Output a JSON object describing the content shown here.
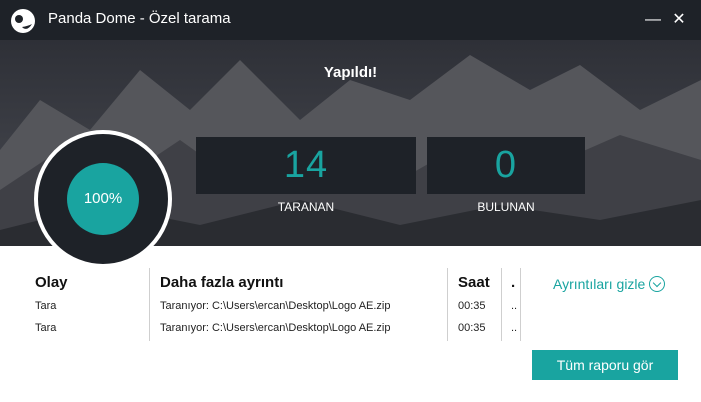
{
  "window": {
    "title": "Panda Dome - Özel tarama",
    "minimize_label": "—",
    "close_label": "✕"
  },
  "hero": {
    "status_text": "Yapıldı!",
    "scanned_count": "14",
    "scanned_label": "TARANAN",
    "found_count": "0",
    "found_label": "BULUNAN",
    "progress_text": "100%",
    "progress_fraction": 1.0
  },
  "table": {
    "headers": {
      "event": "Olay",
      "details": "Daha fazla ayrıntı",
      "time": "Saat",
      "extra": "."
    },
    "rows": [
      {
        "event": "Tara",
        "details": "Taranıyor: C:\\Users\\ercan\\Desktop\\Logo AE.zip",
        "time": "00:35",
        "extra": ".."
      },
      {
        "event": "Tara",
        "details": "Taranıyor: C:\\Users\\ercan\\Desktop\\Logo AE.zip",
        "time": "00:35",
        "extra": ".."
      }
    ]
  },
  "actions": {
    "hide_details_label": "Ayrıntıları gizle",
    "full_report_label": "Tüm raporu gör"
  },
  "colors": {
    "accent": "#19a4a0",
    "dark": "#1e2228"
  },
  "icons": {
    "app_logo": "panda-logo-icon",
    "toggle": "chevron-down-circle-icon"
  }
}
